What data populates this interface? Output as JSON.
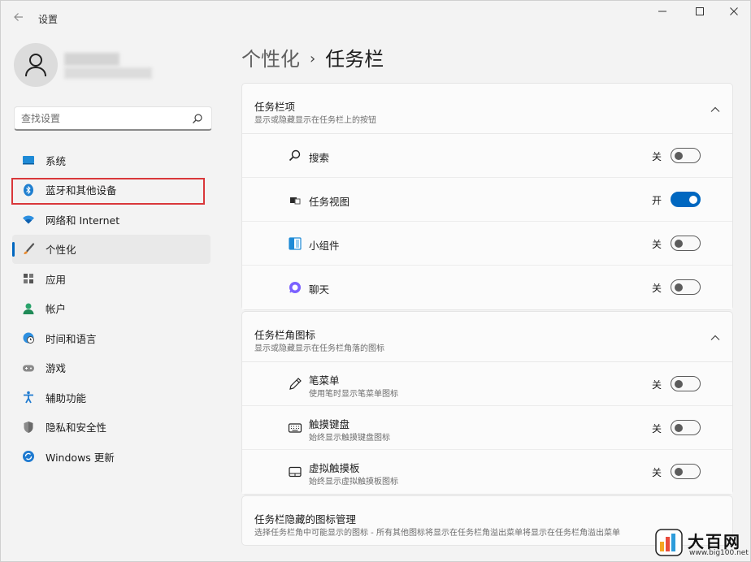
{
  "window": {
    "title": "设置",
    "back_icon": "back-arrow-icon",
    "min_label": "—",
    "max_label": "☐",
    "close_label": "✕"
  },
  "search": {
    "placeholder": "查找设置"
  },
  "sidebar": {
    "items": [
      {
        "label": "系统",
        "icon": "system-icon"
      },
      {
        "label": "蓝牙和其他设备",
        "icon": "bluetooth-icon"
      },
      {
        "label": "网络和 Internet",
        "icon": "wifi-icon"
      },
      {
        "label": "个性化",
        "icon": "brush-icon",
        "selected": true
      },
      {
        "label": "应用",
        "icon": "apps-icon"
      },
      {
        "label": "帐户",
        "icon": "account-icon"
      },
      {
        "label": "时间和语言",
        "icon": "globe-clock-icon"
      },
      {
        "label": "游戏",
        "icon": "gamepad-icon"
      },
      {
        "label": "辅助功能",
        "icon": "accessibility-icon"
      },
      {
        "label": "隐私和安全性",
        "icon": "shield-icon"
      },
      {
        "label": "Windows 更新",
        "icon": "update-icon"
      }
    ]
  },
  "breadcrumb": {
    "parent": "个性化",
    "separator": "›",
    "current": "任务栏"
  },
  "taskbar_items": {
    "title": "任务栏项",
    "subtitle": "显示或隐藏显示在任务栏上的按钮",
    "rows": [
      {
        "label": "搜索",
        "state": "关",
        "on": false
      },
      {
        "label": "任务视图",
        "state": "开",
        "on": true
      },
      {
        "label": "小组件",
        "state": "关",
        "on": false
      },
      {
        "label": "聊天",
        "state": "关",
        "on": false
      }
    ]
  },
  "corner_icons": {
    "title": "任务栏角图标",
    "subtitle": "显示或隐藏显示在任务栏角落的图标",
    "rows": [
      {
        "label": "笔菜单",
        "sub": "使用笔时显示笔菜单图标",
        "state": "关",
        "on": false
      },
      {
        "label": "触摸键盘",
        "sub": "始终显示触摸键盘图标",
        "state": "关",
        "on": false
      },
      {
        "label": "虚拟触摸板",
        "sub": "始终显示虚拟触摸板图标",
        "state": "关",
        "on": false
      }
    ]
  },
  "overflow": {
    "title": "任务栏隐藏的图标管理",
    "subtitle": "选择任务栏角中可能显示的图标 - 所有其他图标将显示在任务栏角溢出菜单将显示在任务栏角溢出菜单"
  },
  "watermark": {
    "name": "大百网",
    "url": "www.big100.net"
  },
  "colors": {
    "accent": "#0067c0",
    "highlight": "#d9373a"
  }
}
